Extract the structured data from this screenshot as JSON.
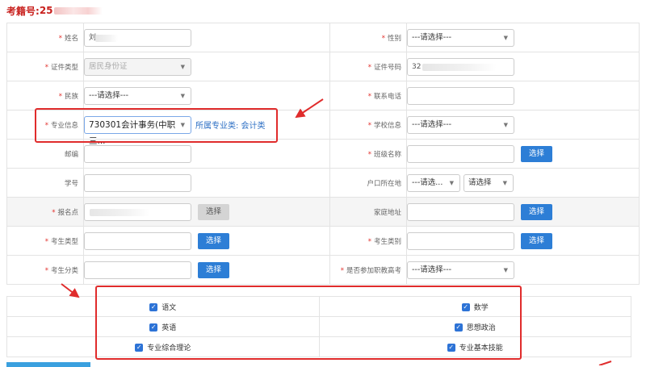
{
  "header": {
    "exam_label": "考籍号:",
    "exam_value": "25"
  },
  "labels": {
    "name": "姓名",
    "gender": "性别",
    "id_type": "证件类型",
    "id_number": "证件号码",
    "ethnicity": "民族",
    "phone": "联系电话",
    "major_info": "专业信息",
    "school_info": "学校信息",
    "postcode": "邮编",
    "class_name": "班级名称",
    "student_no": "学号",
    "hukou": "户口所在地",
    "registration_point": "报名点",
    "home_address": "家庭地址",
    "candidate_type": "考生类型",
    "candidate_category": "考生类别",
    "candidate_class": "考生分类",
    "vocational_exam": "是否参加职教高考"
  },
  "values": {
    "name": "刘",
    "gender": "---请选择---",
    "id_type": "居民身份证",
    "id_number": "32",
    "ethnicity": "---请选择---",
    "major": "730301会计事务(中职三...",
    "major_category": "所属专业类: 会计类",
    "school": "---请选择---",
    "hukou_province": "---请选...",
    "hukou_city": "请选择",
    "registration_point": "",
    "vocational_exam": "---请选择---"
  },
  "buttons": {
    "select": "选择"
  },
  "subjects": [
    "语文",
    "数学",
    "英语",
    "思想政治",
    "专业综合理论",
    "专业基本技能"
  ],
  "colors": {
    "accent": "#2d7ed6",
    "required": "#e2302c",
    "annotation": "#e02c2c"
  }
}
